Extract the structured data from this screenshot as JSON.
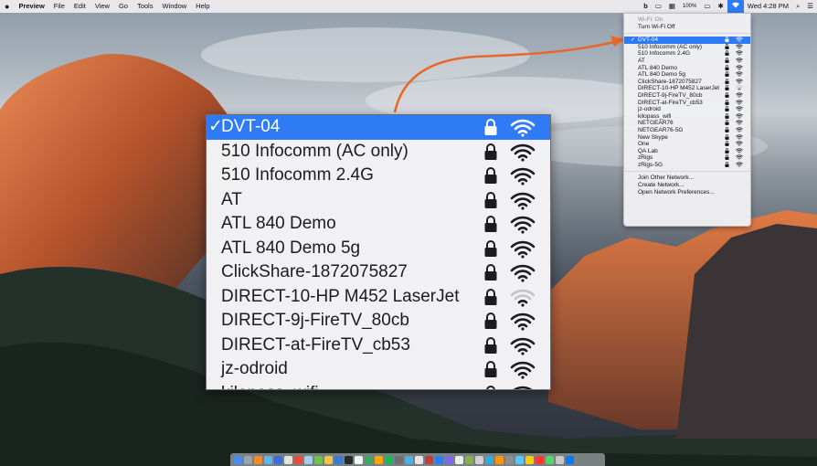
{
  "menubar": {
    "app_name": "Preview",
    "items": [
      "File",
      "Edit",
      "View",
      "Go",
      "Tools",
      "Window",
      "Help"
    ],
    "battery": "100%",
    "clock": "Wed 4:28 PM"
  },
  "wifi_menu": {
    "status": "Wi-Fi: On",
    "toggle": "Turn Wi-Fi Off",
    "networks": [
      {
        "name": "DVT-04",
        "selected": true
      },
      {
        "name": "510 Infocomm (AC only)"
      },
      {
        "name": "510 Infocomm 2.4G"
      },
      {
        "name": "AT"
      },
      {
        "name": "ATL 840 Demo"
      },
      {
        "name": "ATL 840 Demo 5g"
      },
      {
        "name": "ClickShare-1872075827"
      },
      {
        "name": "DIRECT-10-HP M452 LaserJet",
        "weak": true
      },
      {
        "name": "DIRECT-9j-FireTV_80cb"
      },
      {
        "name": "DIRECT-at-FireTV_cb53"
      },
      {
        "name": "jz-odroid"
      },
      {
        "name": "kilopass_wifi"
      },
      {
        "name": "NETGEAR76"
      },
      {
        "name": "NETGEAR76-5G"
      },
      {
        "name": "New Skype"
      },
      {
        "name": "One"
      },
      {
        "name": "QA Lab"
      },
      {
        "name": "zRigs"
      },
      {
        "name": "zRigs-5G"
      }
    ],
    "footer": [
      "Join Other Network...",
      "Create Network...",
      "Open Network Preferences..."
    ]
  },
  "zoom": {
    "networks": [
      {
        "name": "DVT-04",
        "selected": true
      },
      {
        "name": "510 Infocomm (AC only)"
      },
      {
        "name": "510 Infocomm 2.4G"
      },
      {
        "name": "AT"
      },
      {
        "name": "ATL 840 Demo"
      },
      {
        "name": "ATL 840 Demo 5g"
      },
      {
        "name": "ClickShare-1872075827"
      },
      {
        "name": "DIRECT-10-HP M452 LaserJet",
        "weak": true
      },
      {
        "name": "DIRECT-9j-FireTV_80cb"
      },
      {
        "name": "DIRECT-at-FireTV_cb53"
      },
      {
        "name": "jz-odroid"
      },
      {
        "name": "kilopass_wifi"
      }
    ]
  },
  "colors": {
    "accent": "#2f7bf5",
    "arrow": "#e8672a"
  },
  "checkmark": "✓"
}
